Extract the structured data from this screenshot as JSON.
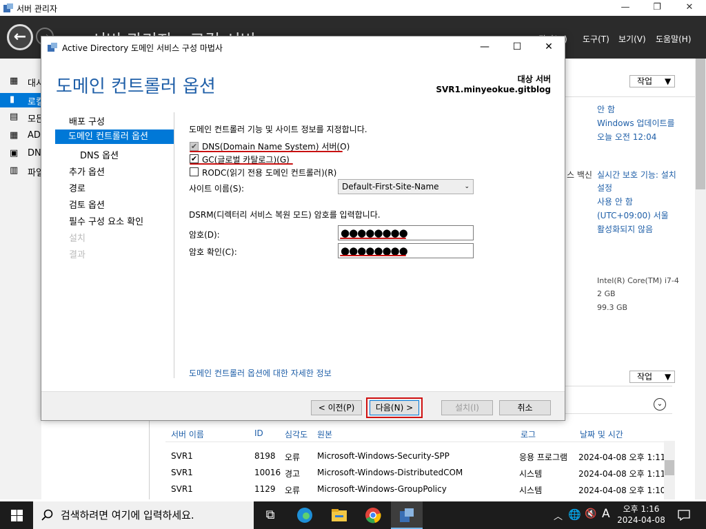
{
  "server_manager": {
    "title": "서버 관리자",
    "big_title": "서버 관리자 › 로컬 서버",
    "menus": [
      "관리(M)",
      "도구(T)",
      "보기(V)",
      "도움말(H)"
    ],
    "nav_items": [
      "대시",
      "로컬",
      "모든",
      "AD",
      "DN",
      "파일"
    ],
    "task_label": "작업",
    "properties": [
      "안 함",
      "Windows 업데이트를",
      "오늘 오전 12:04",
      "실시간 보호 기능: 설치",
      "설정",
      "사용 안 함",
      "(UTC+09:00) 서울",
      "활성화되지 않음"
    ],
    "partial_label": "스 백신",
    "hardware": [
      "Intel(R) Core(TM) i7-4",
      "2 GB",
      "99.3 GB"
    ],
    "events": {
      "headers": [
        "서버 이름",
        "ID",
        "심각도",
        "원본",
        "로그",
        "날짜 및 시간"
      ],
      "rows": [
        [
          "SVR1",
          "8198",
          "오류",
          "Microsoft-Windows-Security-SPP",
          "응용 프로그램",
          "2024-04-08 오후 1:11:1"
        ],
        [
          "SVR1",
          "10016",
          "경고",
          "Microsoft-Windows-DistributedCOM",
          "시스템",
          "2024-04-08 오후 1:11:0"
        ],
        [
          "SVR1",
          "1129",
          "오류",
          "Microsoft-Windows-GroupPolicy",
          "시스템",
          "2024-04-08 오후 1:10:2"
        ]
      ]
    }
  },
  "dialog": {
    "title": "Active Directory 도메인 서비스 구성 마법사",
    "heading": "도메인 컨트롤러 옵션",
    "target_label": "대상 서버",
    "target_value": "SVR1.minyeokue.gitblog",
    "steps": [
      "배포 구성",
      "도메인 컨트롤러 옵션",
      "DNS 옵션",
      "추가 옵션",
      "경로",
      "검토 옵션",
      "필수 구성 요소 확인",
      "설치",
      "결과"
    ],
    "instruction": "도메인 컨트롤러 기능 및 사이트 정보를 지정합니다.",
    "options": [
      {
        "label": "DNS(Domain Name System) 서버(O)",
        "checked": true,
        "disabled": true
      },
      {
        "label": "GC(글로벌 카탈로그)(G)",
        "checked": true,
        "disabled": false
      },
      {
        "label": "RODC(읽기 전용 도메인 컨트롤러)(R)",
        "checked": false,
        "disabled": false
      }
    ],
    "site_label": "사이트 이름(S):",
    "site_value": "Default-First-Site-Name",
    "dsrm_instruction": "DSRM(디렉터리 서비스 복원 모드) 암호를 입력합니다.",
    "password_label": "암호(D):",
    "password_value": "●●●●●●●●",
    "confirm_label": "암호 확인(C):",
    "confirm_value": "●●●●●●●●",
    "more_link": "도메인 컨트롤러 옵션에 대한 자세한 정보",
    "buttons": {
      "prev": "< 이전(P)",
      "next": "다음(N) >",
      "install": "설치(I)",
      "cancel": "취소"
    }
  },
  "taskbar": {
    "search_placeholder": "검색하려면 여기에 입력하세요.",
    "time": "오후 1:16",
    "date": "2024-04-08",
    "ime": "A"
  }
}
